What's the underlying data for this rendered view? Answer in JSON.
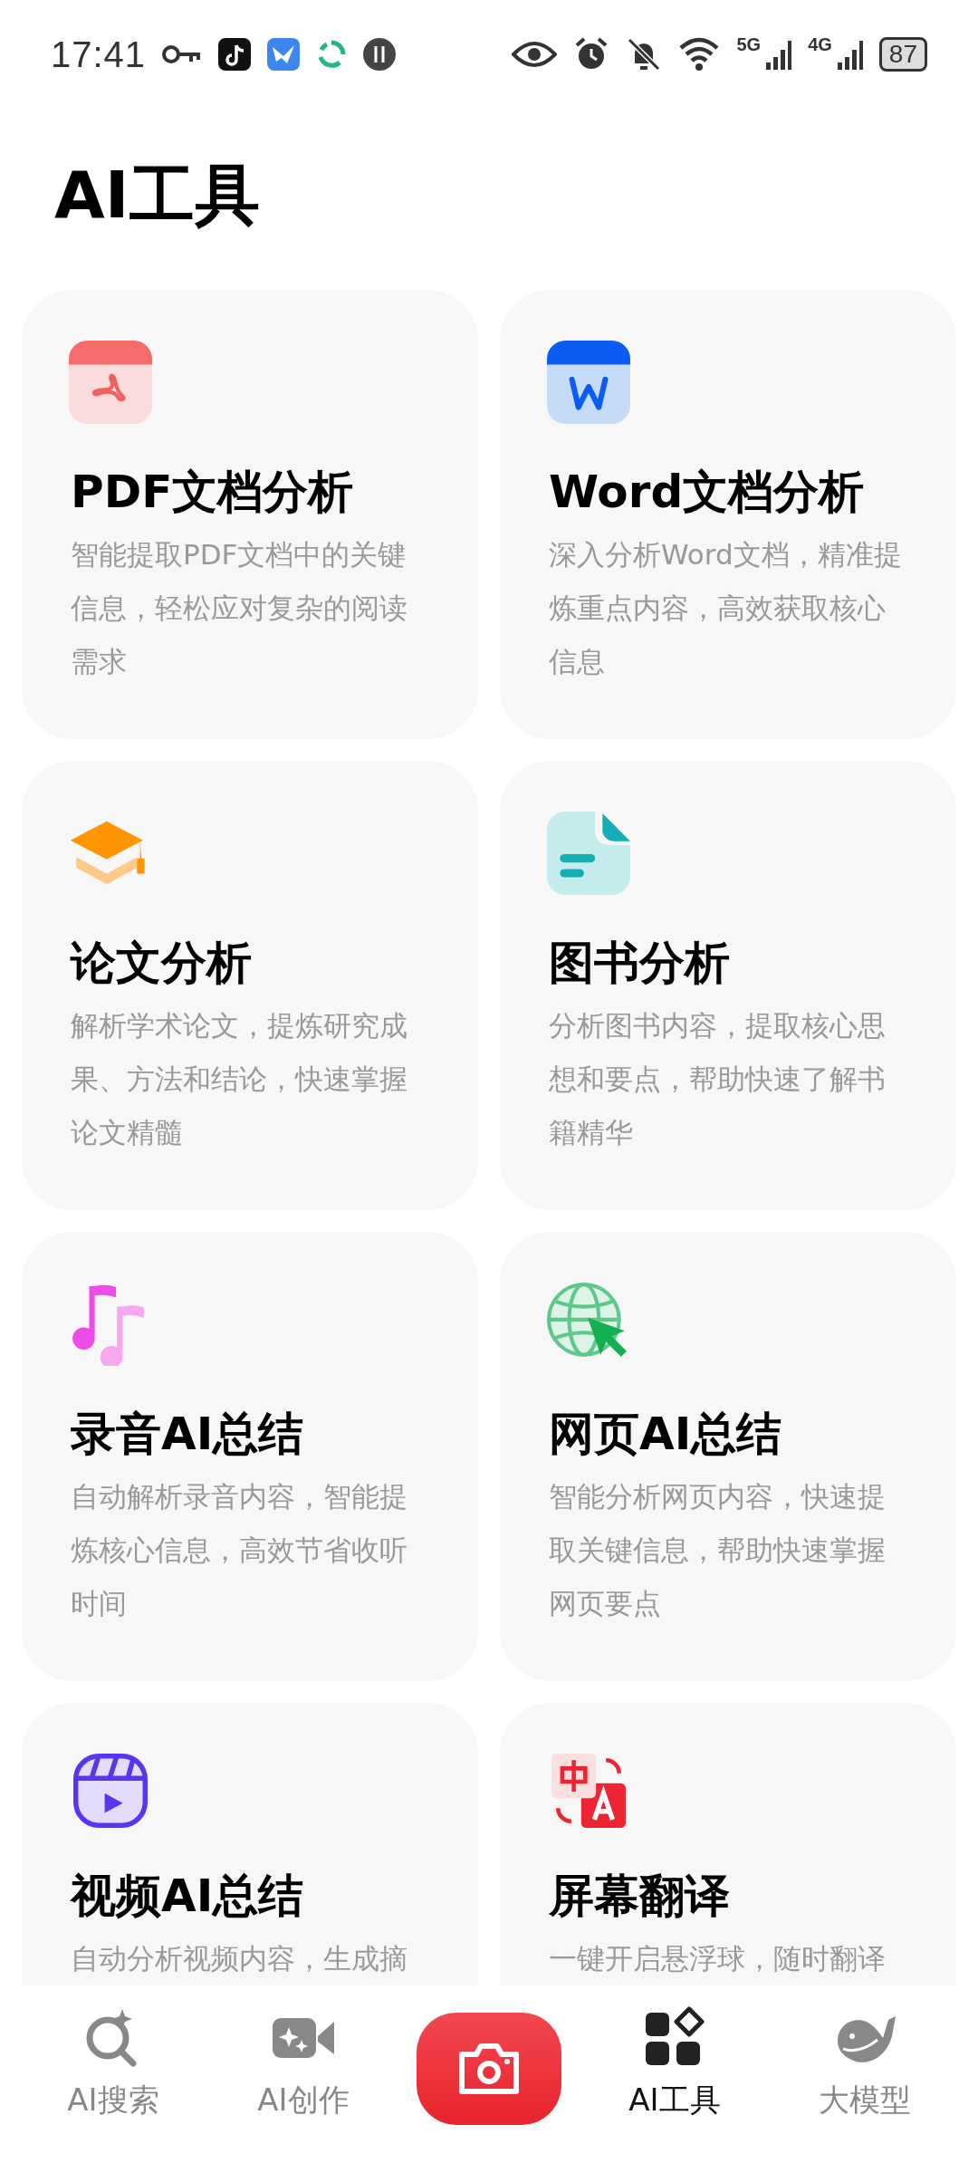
{
  "status_bar": {
    "time": "17:41",
    "network_5g": "5G",
    "network_4g": "4G",
    "battery": "87"
  },
  "page_title": "AI工具",
  "tools": [
    {
      "kind": "pdf",
      "title": "PDF文档分析",
      "description": "智能提取PDF文档中的关键信息，轻松应对复杂的阅读需求"
    },
    {
      "kind": "word",
      "title": "Word文档分析",
      "description": "深入分析Word文档，精准提炼重点内容，高效获取核心信息"
    },
    {
      "kind": "thesis",
      "title": "论文分析",
      "description": "解析学术论文，提炼研究成果、方法和结论，快速掌握论文精髓"
    },
    {
      "kind": "book",
      "title": "图书分析",
      "description": "分析图书内容，提取核心思想和要点，帮助快速了解书籍精华"
    },
    {
      "kind": "audio",
      "title": "录音AI总结",
      "description": "自动解析录音内容，智能提炼核心信息，高效节省收听时间"
    },
    {
      "kind": "web",
      "title": "网页AI总结",
      "description": "智能分析网页内容，快速提取关键信息，帮助快速掌握网页要点"
    },
    {
      "kind": "video",
      "title": "视频AI总结",
      "description": "自动分析视频内容，生成摘"
    },
    {
      "kind": "translate",
      "title": "屏幕翻译",
      "description": "一键开启悬浮球，随时翻译"
    }
  ],
  "bottom_nav": [
    {
      "kind": "search",
      "label": "AI搜索",
      "selected": false
    },
    {
      "kind": "create",
      "label": "AI创作",
      "selected": false
    },
    {
      "kind": "camera"
    },
    {
      "kind": "tools",
      "label": "AI工具",
      "selected": true
    },
    {
      "kind": "model",
      "label": "大模型",
      "selected": false
    }
  ]
}
